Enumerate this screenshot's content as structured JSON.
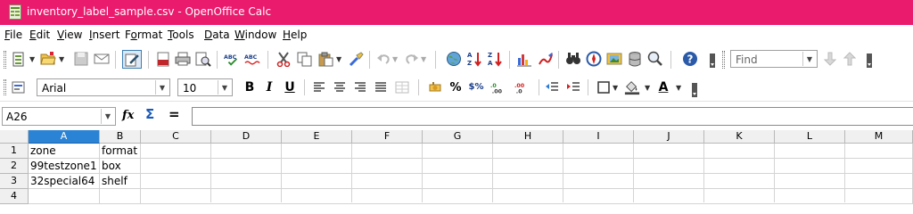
{
  "window": {
    "title": "inventory_label_sample.csv - OpenOffice Calc",
    "accent_color": "#ea1a6d"
  },
  "menu": [
    {
      "accel": "F",
      "rest": "ile"
    },
    {
      "accel": "E",
      "rest": "dit"
    },
    {
      "accel": "V",
      "rest": "iew"
    },
    {
      "accel": "I",
      "rest": "nsert"
    },
    {
      "pre": "F",
      "accel": "o",
      "rest": "rmat"
    },
    {
      "accel": "T",
      "rest": "ools"
    },
    {
      "accel": "D",
      "rest": "ata"
    },
    {
      "accel": "W",
      "rest": "indow"
    },
    {
      "accel": "H",
      "rest": "elp"
    }
  ],
  "toolbar1": {
    "icons": [
      "new-icon",
      "open-icon",
      "save-icon",
      "email-icon",
      "edit-file-icon",
      "export-pdf-icon",
      "print-icon",
      "print-preview-icon",
      "spellcheck-icon",
      "autospellcheck-icon",
      "cut-icon",
      "copy-icon",
      "paste-icon",
      "clone-formatting-icon",
      "undo-icon",
      "redo-icon",
      "hyperlink-icon",
      "sort-ascending-icon",
      "sort-descending-icon",
      "chart-icon",
      "draw-functions-icon",
      "find-replace-icon",
      "navigator-icon",
      "gallery-icon",
      "data-sources-icon",
      "zoom-icon",
      "help-icon"
    ],
    "find_placeholder": "Find"
  },
  "toolbar2": {
    "font_name": "Arial",
    "font_size": "10",
    "bold_label": "B",
    "italic_label": "I",
    "underline_label": "U",
    "percent_label": "%",
    "currency_label": "$%",
    "font_color_label": "A"
  },
  "formula_bar": {
    "cell_reference": "A26",
    "function_wizard_label": "fx",
    "sum_label": "Σ",
    "equals_label": "=",
    "content": ""
  },
  "sheet": {
    "columns": [
      "A",
      "B",
      "C",
      "D",
      "E",
      "F",
      "G",
      "H",
      "I",
      "J",
      "K",
      "L",
      "M"
    ],
    "active_column": "A",
    "rows": [
      {
        "num": "1",
        "cells": [
          "zone",
          "format"
        ]
      },
      {
        "num": "2",
        "cells": [
          "99testzone1",
          "box"
        ]
      },
      {
        "num": "3",
        "cells": [
          "32special64",
          "shelf"
        ]
      },
      {
        "num": "4",
        "cells": [
          "",
          ""
        ]
      }
    ]
  }
}
